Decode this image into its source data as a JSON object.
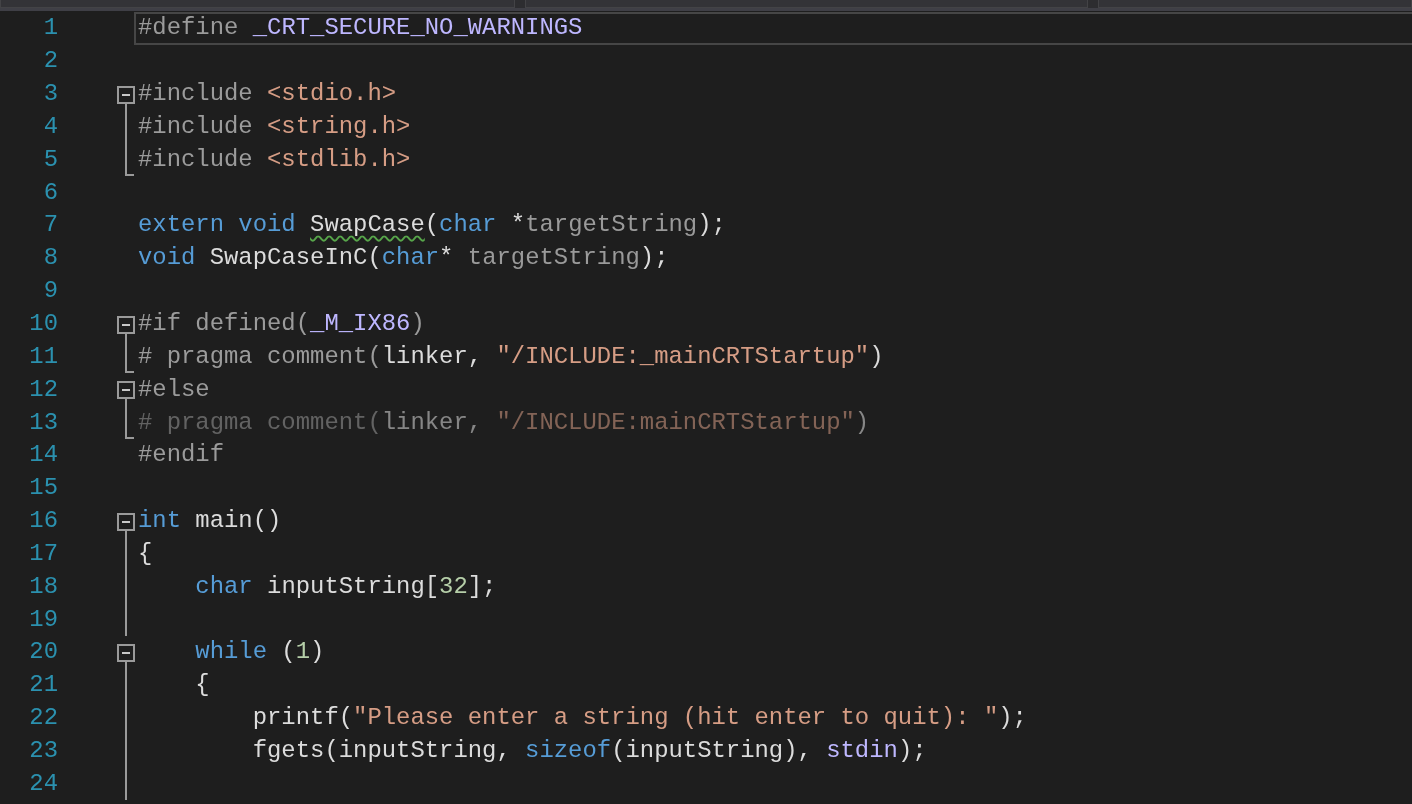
{
  "navigation_bar": {
    "dropdowns": [
      {
        "kind": "project"
      },
      {
        "kind": "scope"
      },
      {
        "kind": "member"
      }
    ]
  },
  "editor": {
    "lines": [
      {
        "number": "1",
        "kind": "plain",
        "current": true,
        "inactive": false,
        "tokens": [
          {
            "text": "#define ",
            "kind": "preproc"
          },
          {
            "text": "_CRT_SECURE_NO_WARNINGS",
            "kind": "macro"
          }
        ]
      },
      {
        "number": "2",
        "kind": "plain",
        "current": false
      },
      {
        "number": "3",
        "kind": "fold-start",
        "current": false,
        "inactive": false,
        "tokens": [
          {
            "text": "#include ",
            "kind": "preproc"
          },
          {
            "text": "<stdio.h>",
            "kind": "string"
          }
        ]
      },
      {
        "number": "4",
        "kind": "fold-body",
        "current": false,
        "inactive": false,
        "tokens": [
          {
            "text": "#include ",
            "kind": "preproc"
          },
          {
            "text": "<string.h>",
            "kind": "string"
          }
        ]
      },
      {
        "number": "5",
        "kind": "fold-end",
        "current": false,
        "inactive": false,
        "tokens": [
          {
            "text": "#include ",
            "kind": "preproc"
          },
          {
            "text": "<stdlib.h>",
            "kind": "string"
          }
        ]
      },
      {
        "number": "6",
        "kind": "plain",
        "current": false
      },
      {
        "number": "7",
        "kind": "plain",
        "current": false,
        "inactive": false,
        "tokens": [
          {
            "text": "extern void ",
            "kind": "keyword"
          },
          {
            "text": "SwapCase",
            "kind": "squiggled"
          },
          {
            "text": "(",
            "kind": "plain"
          },
          {
            "text": "char",
            "kind": "keyword"
          },
          {
            "text": " *",
            "kind": "plain"
          },
          {
            "text": "targetString",
            "kind": "param"
          },
          {
            "text": ");",
            "kind": "plain"
          }
        ]
      },
      {
        "number": "8",
        "kind": "plain",
        "current": false,
        "inactive": false,
        "tokens": [
          {
            "text": "void",
            "kind": "keyword"
          },
          {
            "text": " SwapCaseInC(",
            "kind": "plain"
          },
          {
            "text": "char",
            "kind": "keyword"
          },
          {
            "text": "* ",
            "kind": "plain"
          },
          {
            "text": "targetString",
            "kind": "param"
          },
          {
            "text": ");",
            "kind": "plain"
          }
        ]
      },
      {
        "number": "9",
        "kind": "plain",
        "current": false
      },
      {
        "number": "10",
        "kind": "fold-start",
        "current": false,
        "inactive": false,
        "tokens": [
          {
            "text": "#if defined(",
            "kind": "preproc"
          },
          {
            "text": "_M_IX86",
            "kind": "macro"
          },
          {
            "text": ")",
            "kind": "preproc"
          }
        ]
      },
      {
        "number": "11",
        "kind": "fold-end",
        "current": false,
        "inactive": false,
        "tokens": [
          {
            "text": "# pragma comment(",
            "kind": "preproc"
          },
          {
            "text": "linker, ",
            "kind": "plain"
          },
          {
            "text": "\"/INCLUDE:_mainCRTStartup\"",
            "kind": "string"
          },
          {
            "text": ")",
            "kind": "plain"
          }
        ]
      },
      {
        "number": "12",
        "kind": "fold-start",
        "current": false,
        "inactive": false,
        "tokens": [
          {
            "text": "#else",
            "kind": "preproc"
          }
        ]
      },
      {
        "number": "13",
        "kind": "fold-end",
        "current": false,
        "inactive": true,
        "tokens": [
          {
            "text": "# pragma comment(",
            "kind": "preproc"
          },
          {
            "text": "linker, ",
            "kind": "plain"
          },
          {
            "text": "\"/INCLUDE:mainCRTStartup\"",
            "kind": "string"
          },
          {
            "text": ")",
            "kind": "plain"
          }
        ]
      },
      {
        "number": "14",
        "kind": "plain",
        "current": false,
        "inactive": false,
        "tokens": [
          {
            "text": "#endif",
            "kind": "preproc"
          }
        ]
      },
      {
        "number": "15",
        "kind": "plain",
        "current": false
      },
      {
        "number": "16",
        "kind": "fold-start",
        "current": false,
        "inactive": false,
        "tokens": [
          {
            "text": "int",
            "kind": "keyword"
          },
          {
            "text": " main()",
            "kind": "plain"
          }
        ]
      },
      {
        "number": "17",
        "kind": "fold-body",
        "current": false,
        "inactive": false,
        "tokens": [
          {
            "text": "{",
            "kind": "plain"
          }
        ]
      },
      {
        "number": "18",
        "kind": "fold-body",
        "current": false,
        "inactive": false,
        "tokens": [
          {
            "text": "    char",
            "kind": "keyword"
          },
          {
            "text": " inputString[",
            "kind": "plain"
          },
          {
            "text": "32",
            "kind": "number"
          },
          {
            "text": "];",
            "kind": "plain"
          }
        ]
      },
      {
        "number": "19",
        "kind": "fold-body",
        "current": false
      },
      {
        "number": "20",
        "kind": "fold-start",
        "current": false,
        "inactive": false,
        "tokens": [
          {
            "text": "    while",
            "kind": "keyword"
          },
          {
            "text": " (",
            "kind": "plain"
          },
          {
            "text": "1",
            "kind": "number"
          },
          {
            "text": ")",
            "kind": "plain"
          }
        ]
      },
      {
        "number": "21",
        "kind": "fold-body",
        "current": false,
        "inactive": false,
        "tokens": [
          {
            "text": "    {",
            "kind": "plain"
          }
        ]
      },
      {
        "number": "22",
        "kind": "fold-body",
        "current": false,
        "inactive": false,
        "tokens": [
          {
            "text": "        printf(",
            "kind": "plain"
          },
          {
            "text": "\"Please enter a string (hit enter to quit): \"",
            "kind": "string"
          },
          {
            "text": ");",
            "kind": "plain"
          }
        ]
      },
      {
        "number": "23",
        "kind": "fold-body",
        "current": false,
        "inactive": false,
        "tokens": [
          {
            "text": "        fgets(inputString, ",
            "kind": "plain"
          },
          {
            "text": "sizeof",
            "kind": "keyword"
          },
          {
            "text": "(inputString), ",
            "kind": "plain"
          },
          {
            "text": "stdin",
            "kind": "macro"
          },
          {
            "text": ");",
            "kind": "plain"
          }
        ]
      },
      {
        "number": "24",
        "kind": "fold-body",
        "current": false
      }
    ]
  }
}
